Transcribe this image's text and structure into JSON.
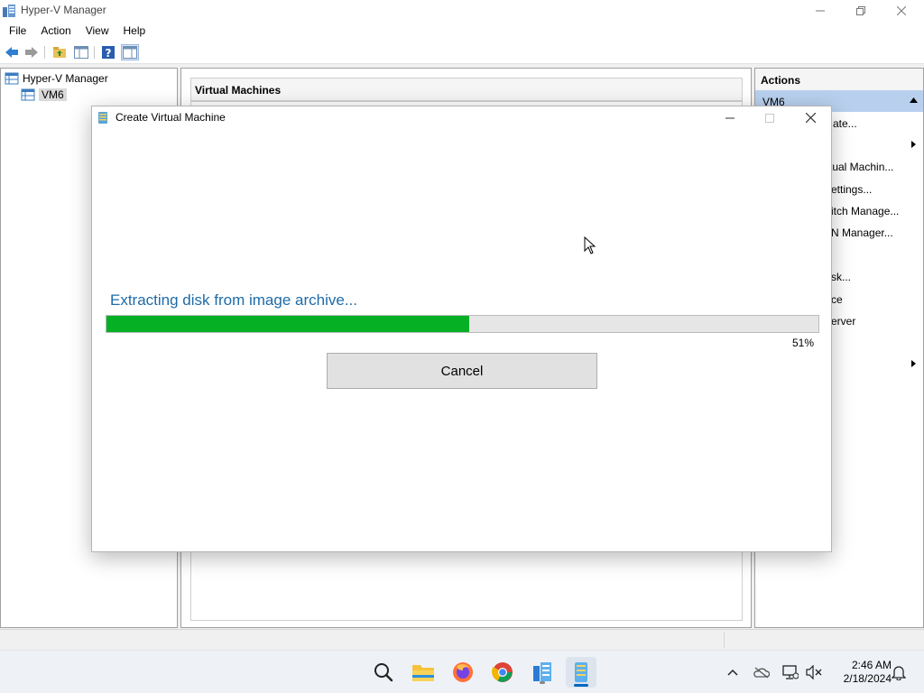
{
  "window": {
    "title": "Hyper-V Manager",
    "controls": [
      "minimize-icon",
      "restore-icon",
      "close-icon"
    ]
  },
  "menu": {
    "items": [
      "File",
      "Action",
      "View",
      "Help"
    ]
  },
  "toolbar": {
    "icons": [
      "back-arrow-icon",
      "forward-arrow-icon",
      "folder-up-icon",
      "show-hide-console-tree-icon",
      "help-icon",
      "properties-icon"
    ]
  },
  "tree": {
    "root": "Hyper-V Manager",
    "child": "VM6"
  },
  "center": {
    "header": "Virtual Machines"
  },
  "actions": {
    "header": "Actions",
    "group": "VM6",
    "items": [
      "ate...",
      "tual Machin...",
      "ettings...",
      "itch Manage...",
      "N Manager...",
      "sk...",
      "ce",
      "erver"
    ]
  },
  "dialog": {
    "title": "Create Virtual Machine",
    "status": "Extracting disk from image archive...",
    "progress_fraction": 0.51,
    "progress_text": "51%",
    "cancel_label": "Cancel"
  },
  "taskbar": {
    "apps": [
      "search-icon",
      "file-explorer-icon",
      "firefox-icon",
      "chrome-icon",
      "hyper-v-manager-icon",
      "hyper-v-quick-create-icon"
    ],
    "tray": [
      "chevron-up-icon",
      "onedrive-icon",
      "network-icon",
      "volume-muted-icon",
      "notifications-icon"
    ],
    "time": "2:46 AM",
    "date": "2/18/2024"
  },
  "colors": {
    "progress_fill": "#06b025",
    "status_text": "#1e6ba8",
    "selection": "#b8d0ee"
  }
}
